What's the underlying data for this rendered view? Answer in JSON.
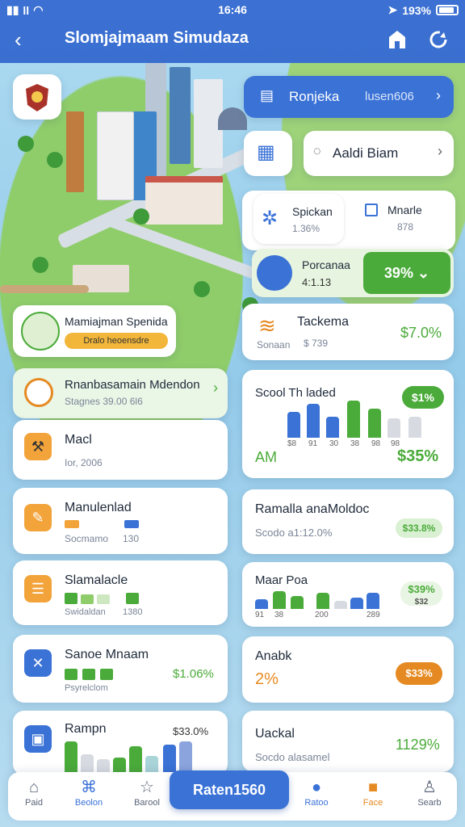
{
  "status": {
    "time": "16:46",
    "battery": "193%",
    "signal": "ll"
  },
  "header": {
    "title": "Slomjajmaam Simudaza"
  },
  "top_right": {
    "btn1_label": "Ronjeka",
    "btn1_value": "lusen606",
    "btn2_label": "Aaldi Biam"
  },
  "right_cards": {
    "c1": {
      "title": "Spickan",
      "sub": "1.36%"
    },
    "c2": {
      "title": "Mnarle",
      "sub": "878"
    },
    "c3": {
      "title": "Porcanaa",
      "sub": "4:1.13",
      "pill": "39%"
    },
    "c4": {
      "title": "Tackema",
      "sub1": "Sonaan",
      "sub2": "$ 739",
      "value": "$7.0%"
    },
    "c5": {
      "title": "Scool Th laded",
      "pill": "$1%",
      "left": "AM",
      "value": "$35%",
      "ticks": [
        "$8",
        "91",
        "30",
        "38",
        "98",
        "98"
      ]
    },
    "c6": {
      "title": "Ramalla anaMoldoc",
      "sub": "Scodo a1:12.0%",
      "pill": "$33.8%"
    },
    "c7": {
      "title": "Maar Poa",
      "value": "$39%",
      "value2": "$32",
      "ticks": [
        "91",
        "38",
        "200",
        "289"
      ]
    },
    "c8": {
      "title": "Anabk",
      "value": "2%",
      "pill": "$33%"
    },
    "c9": {
      "title": "Uackal",
      "sub": "Socdo alasamel",
      "value": "1129%"
    }
  },
  "left_cards": {
    "promo": {
      "title": "Mamiajman Spenida",
      "badge": "Dralo heoensdre"
    },
    "l1": {
      "title": "Rnanbasamain Mdendon",
      "sub": "Stagnes 39.00 6l6"
    },
    "l2": {
      "title": "Macl",
      "sub": "Ior, 2006"
    },
    "l3": {
      "title": "Manulenlad",
      "sub": "Socmamo",
      "sub2": "130"
    },
    "l4": {
      "title": "Slamalacle",
      "sub": "Swidaldan",
      "sub2": "1380"
    },
    "l5": {
      "title": "Sanoe Mnaam",
      "sub": "Psyrelclom",
      "value": "$1.06%"
    },
    "l6": {
      "title": "Rampn",
      "value": "$33.0%"
    }
  },
  "nav": {
    "items": [
      "Paid",
      "Beolon",
      "Barool",
      "Ratoo",
      "Face",
      "Searb"
    ],
    "center": "Raten1560"
  },
  "colors": {
    "accent": "#3a72d6",
    "green": "#4bab3a",
    "orange": "#e58a22"
  }
}
